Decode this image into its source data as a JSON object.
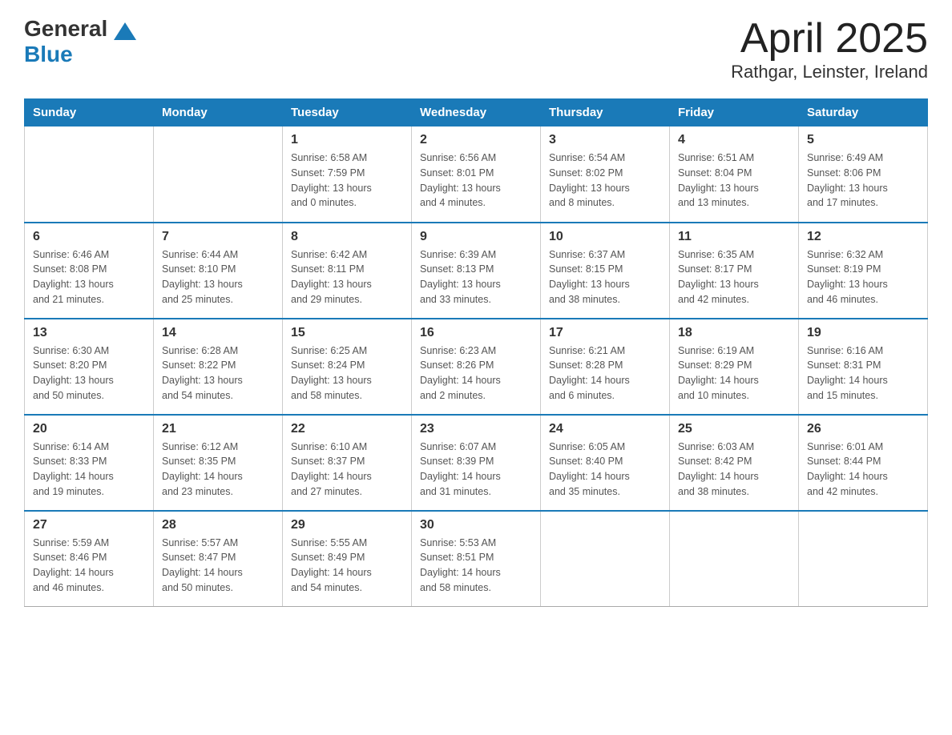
{
  "header": {
    "logo_general": "General",
    "logo_blue": "Blue",
    "month_title": "April 2025",
    "location": "Rathgar, Leinster, Ireland"
  },
  "days_of_week": [
    "Sunday",
    "Monday",
    "Tuesday",
    "Wednesday",
    "Thursday",
    "Friday",
    "Saturday"
  ],
  "weeks": [
    [
      {
        "day": "",
        "info": ""
      },
      {
        "day": "",
        "info": ""
      },
      {
        "day": "1",
        "info": "Sunrise: 6:58 AM\nSunset: 7:59 PM\nDaylight: 13 hours\nand 0 minutes."
      },
      {
        "day": "2",
        "info": "Sunrise: 6:56 AM\nSunset: 8:01 PM\nDaylight: 13 hours\nand 4 minutes."
      },
      {
        "day": "3",
        "info": "Sunrise: 6:54 AM\nSunset: 8:02 PM\nDaylight: 13 hours\nand 8 minutes."
      },
      {
        "day": "4",
        "info": "Sunrise: 6:51 AM\nSunset: 8:04 PM\nDaylight: 13 hours\nand 13 minutes."
      },
      {
        "day": "5",
        "info": "Sunrise: 6:49 AM\nSunset: 8:06 PM\nDaylight: 13 hours\nand 17 minutes."
      }
    ],
    [
      {
        "day": "6",
        "info": "Sunrise: 6:46 AM\nSunset: 8:08 PM\nDaylight: 13 hours\nand 21 minutes."
      },
      {
        "day": "7",
        "info": "Sunrise: 6:44 AM\nSunset: 8:10 PM\nDaylight: 13 hours\nand 25 minutes."
      },
      {
        "day": "8",
        "info": "Sunrise: 6:42 AM\nSunset: 8:11 PM\nDaylight: 13 hours\nand 29 minutes."
      },
      {
        "day": "9",
        "info": "Sunrise: 6:39 AM\nSunset: 8:13 PM\nDaylight: 13 hours\nand 33 minutes."
      },
      {
        "day": "10",
        "info": "Sunrise: 6:37 AM\nSunset: 8:15 PM\nDaylight: 13 hours\nand 38 minutes."
      },
      {
        "day": "11",
        "info": "Sunrise: 6:35 AM\nSunset: 8:17 PM\nDaylight: 13 hours\nand 42 minutes."
      },
      {
        "day": "12",
        "info": "Sunrise: 6:32 AM\nSunset: 8:19 PM\nDaylight: 13 hours\nand 46 minutes."
      }
    ],
    [
      {
        "day": "13",
        "info": "Sunrise: 6:30 AM\nSunset: 8:20 PM\nDaylight: 13 hours\nand 50 minutes."
      },
      {
        "day": "14",
        "info": "Sunrise: 6:28 AM\nSunset: 8:22 PM\nDaylight: 13 hours\nand 54 minutes."
      },
      {
        "day": "15",
        "info": "Sunrise: 6:25 AM\nSunset: 8:24 PM\nDaylight: 13 hours\nand 58 minutes."
      },
      {
        "day": "16",
        "info": "Sunrise: 6:23 AM\nSunset: 8:26 PM\nDaylight: 14 hours\nand 2 minutes."
      },
      {
        "day": "17",
        "info": "Sunrise: 6:21 AM\nSunset: 8:28 PM\nDaylight: 14 hours\nand 6 minutes."
      },
      {
        "day": "18",
        "info": "Sunrise: 6:19 AM\nSunset: 8:29 PM\nDaylight: 14 hours\nand 10 minutes."
      },
      {
        "day": "19",
        "info": "Sunrise: 6:16 AM\nSunset: 8:31 PM\nDaylight: 14 hours\nand 15 minutes."
      }
    ],
    [
      {
        "day": "20",
        "info": "Sunrise: 6:14 AM\nSunset: 8:33 PM\nDaylight: 14 hours\nand 19 minutes."
      },
      {
        "day": "21",
        "info": "Sunrise: 6:12 AM\nSunset: 8:35 PM\nDaylight: 14 hours\nand 23 minutes."
      },
      {
        "day": "22",
        "info": "Sunrise: 6:10 AM\nSunset: 8:37 PM\nDaylight: 14 hours\nand 27 minutes."
      },
      {
        "day": "23",
        "info": "Sunrise: 6:07 AM\nSunset: 8:39 PM\nDaylight: 14 hours\nand 31 minutes."
      },
      {
        "day": "24",
        "info": "Sunrise: 6:05 AM\nSunset: 8:40 PM\nDaylight: 14 hours\nand 35 minutes."
      },
      {
        "day": "25",
        "info": "Sunrise: 6:03 AM\nSunset: 8:42 PM\nDaylight: 14 hours\nand 38 minutes."
      },
      {
        "day": "26",
        "info": "Sunrise: 6:01 AM\nSunset: 8:44 PM\nDaylight: 14 hours\nand 42 minutes."
      }
    ],
    [
      {
        "day": "27",
        "info": "Sunrise: 5:59 AM\nSunset: 8:46 PM\nDaylight: 14 hours\nand 46 minutes."
      },
      {
        "day": "28",
        "info": "Sunrise: 5:57 AM\nSunset: 8:47 PM\nDaylight: 14 hours\nand 50 minutes."
      },
      {
        "day": "29",
        "info": "Sunrise: 5:55 AM\nSunset: 8:49 PM\nDaylight: 14 hours\nand 54 minutes."
      },
      {
        "day": "30",
        "info": "Sunrise: 5:53 AM\nSunset: 8:51 PM\nDaylight: 14 hours\nand 58 minutes."
      },
      {
        "day": "",
        "info": ""
      },
      {
        "day": "",
        "info": ""
      },
      {
        "day": "",
        "info": ""
      }
    ]
  ]
}
